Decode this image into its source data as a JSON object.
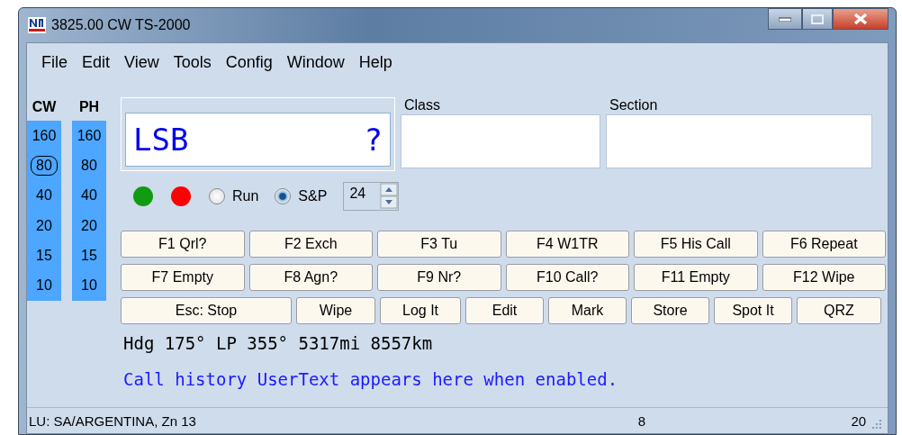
{
  "window": {
    "title": "3825.00 CW TS-2000"
  },
  "menu": [
    "File",
    "Edit",
    "View",
    "Tools",
    "Config",
    "Window",
    "Help"
  ],
  "bands": [
    {
      "header": "CW",
      "items": [
        {
          "label": "160",
          "selected": false
        },
        {
          "label": "80",
          "selected": true
        },
        {
          "label": "40",
          "selected": false
        },
        {
          "label": "20",
          "selected": false
        },
        {
          "label": "15",
          "selected": false
        },
        {
          "label": "10",
          "selected": false
        }
      ]
    },
    {
      "header": "PH",
      "items": [
        {
          "label": "160",
          "selected": false
        },
        {
          "label": "80",
          "selected": false
        },
        {
          "label": "40",
          "selected": false
        },
        {
          "label": "20",
          "selected": false
        },
        {
          "label": "15",
          "selected": false
        },
        {
          "label": "10",
          "selected": false
        }
      ]
    }
  ],
  "call_field": {
    "value": "LSB",
    "flag": "?"
  },
  "class_field": {
    "label": "Class"
  },
  "section_field": {
    "label": "Section"
  },
  "indicators": [
    {
      "color": "#109c10"
    },
    {
      "color": "#ff0000"
    }
  ],
  "modes": [
    {
      "label": "Run",
      "selected": false
    },
    {
      "label": "S&P",
      "selected": true
    }
  ],
  "spinner": {
    "value": "24"
  },
  "function_keys": [
    {
      "label": "F1 Qrl?"
    },
    {
      "label": "F2 Exch"
    },
    {
      "label": "F3 Tu"
    },
    {
      "label": "F4 W1TR"
    },
    {
      "label": "F5 His Call"
    },
    {
      "label": "F6 Repeat"
    },
    {
      "label": "F7 Empty"
    },
    {
      "label": "F8 Agn?"
    },
    {
      "label": "F9 Nr?"
    },
    {
      "label": "F10 Call?"
    },
    {
      "label": "F11 Empty"
    },
    {
      "label": "F12 Wipe"
    }
  ],
  "action_buttons": [
    {
      "label": "Esc: Stop"
    },
    {
      "label": "Wipe"
    },
    {
      "label": "Log It"
    },
    {
      "label": "Edit"
    },
    {
      "label": "Mark"
    },
    {
      "label": "Store"
    },
    {
      "label": "Spot It"
    },
    {
      "label": "QRZ"
    }
  ],
  "heading_info": "Hdg 175° LP 355° 5317mi 8557km",
  "user_text": "Call history UserText appears here when enabled.",
  "status_bar": {
    "location": "LU: SA/ARGENTINA, Zn 13",
    "count": "8",
    "zone": "20"
  }
}
